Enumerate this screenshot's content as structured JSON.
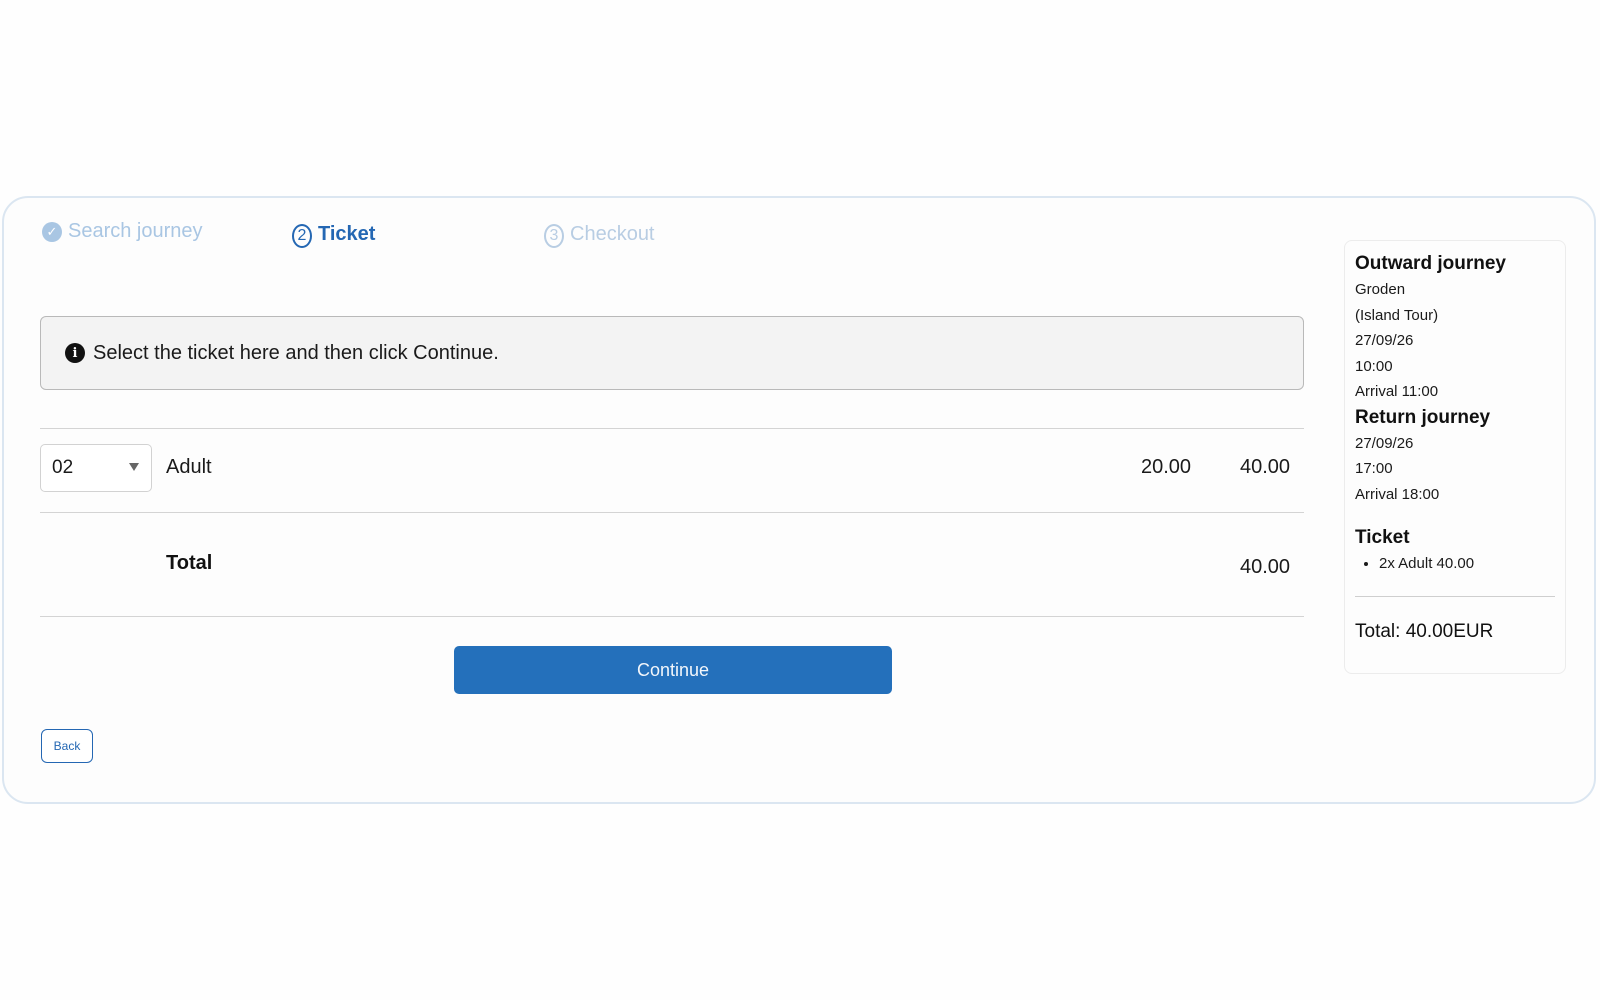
{
  "stepper": {
    "steps": [
      {
        "label": "Search journey",
        "state": "completed",
        "icon": "check-circle-icon"
      },
      {
        "label": "Ticket",
        "state": "active",
        "number": "2"
      },
      {
        "label": "Checkout",
        "state": "pending",
        "number": "3"
      }
    ]
  },
  "info": {
    "icon": "info-icon",
    "message": "Select the ticket here and then click Continue."
  },
  "ticket_row": {
    "quantity": "02",
    "type": "Adult",
    "unit_price": "20.00",
    "line_total": "40.00"
  },
  "total": {
    "label": "Total",
    "value": "40.00"
  },
  "buttons": {
    "continue": "Continue",
    "back": "Back"
  },
  "summary": {
    "outward": {
      "heading": "Outward journey",
      "lines": [
        "Groden",
        "(Island Tour)",
        "27/09/26",
        "10:00",
        "Arrival 11:00"
      ]
    },
    "return": {
      "heading": "Return journey",
      "lines": [
        "27/09/26",
        "17:00",
        "Arrival 18:00"
      ]
    },
    "ticket": {
      "heading": "Ticket",
      "items": [
        "2x Adult 40.00"
      ]
    },
    "total": "Total: 40.00EUR"
  },
  "colors": {
    "accent": "#2470bb",
    "active_step": "#2467b3",
    "completed_step": "#a9c6e3",
    "pending_step": "#b8cde3"
  }
}
